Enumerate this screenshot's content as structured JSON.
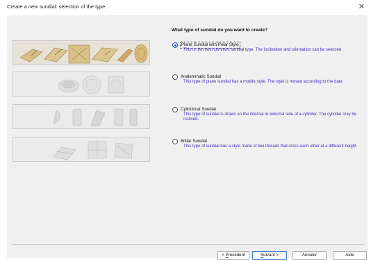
{
  "window": {
    "title": "Create a new sundial: selection of the type",
    "close_icon": "close-icon"
  },
  "heading": "What type of sundial do you want to create?",
  "options": [
    {
      "label": "Plane Sundial with Polar Style",
      "description": "This is the most common sundial type. The inclination and orientation can be selected.",
      "selected": true
    },
    {
      "label": "Analemmatic Sundial",
      "description": "This type of plane sundial has a mobile style. The style is moved according to the date.",
      "selected": false
    },
    {
      "label": "Cylindrical Sundial",
      "description": "This type of sundial is drawn on the internal or external side of a cylinder. The cylinder may be inclined.",
      "selected": false
    },
    {
      "label": "Bifilar Sundial",
      "description": "This type of sundial has a style made of two threads that cross each other at a different height.",
      "selected": false
    }
  ],
  "buttons": {
    "previous": {
      "pre": "< ",
      "key": "P",
      "rest": "récédent"
    },
    "next": {
      "key": "S",
      "rest": "uivant >"
    },
    "cancel": "Annuler",
    "help": "Aide"
  },
  "colors": {
    "accent": "#1e5fc4",
    "description_text": "#3b2fbd"
  }
}
